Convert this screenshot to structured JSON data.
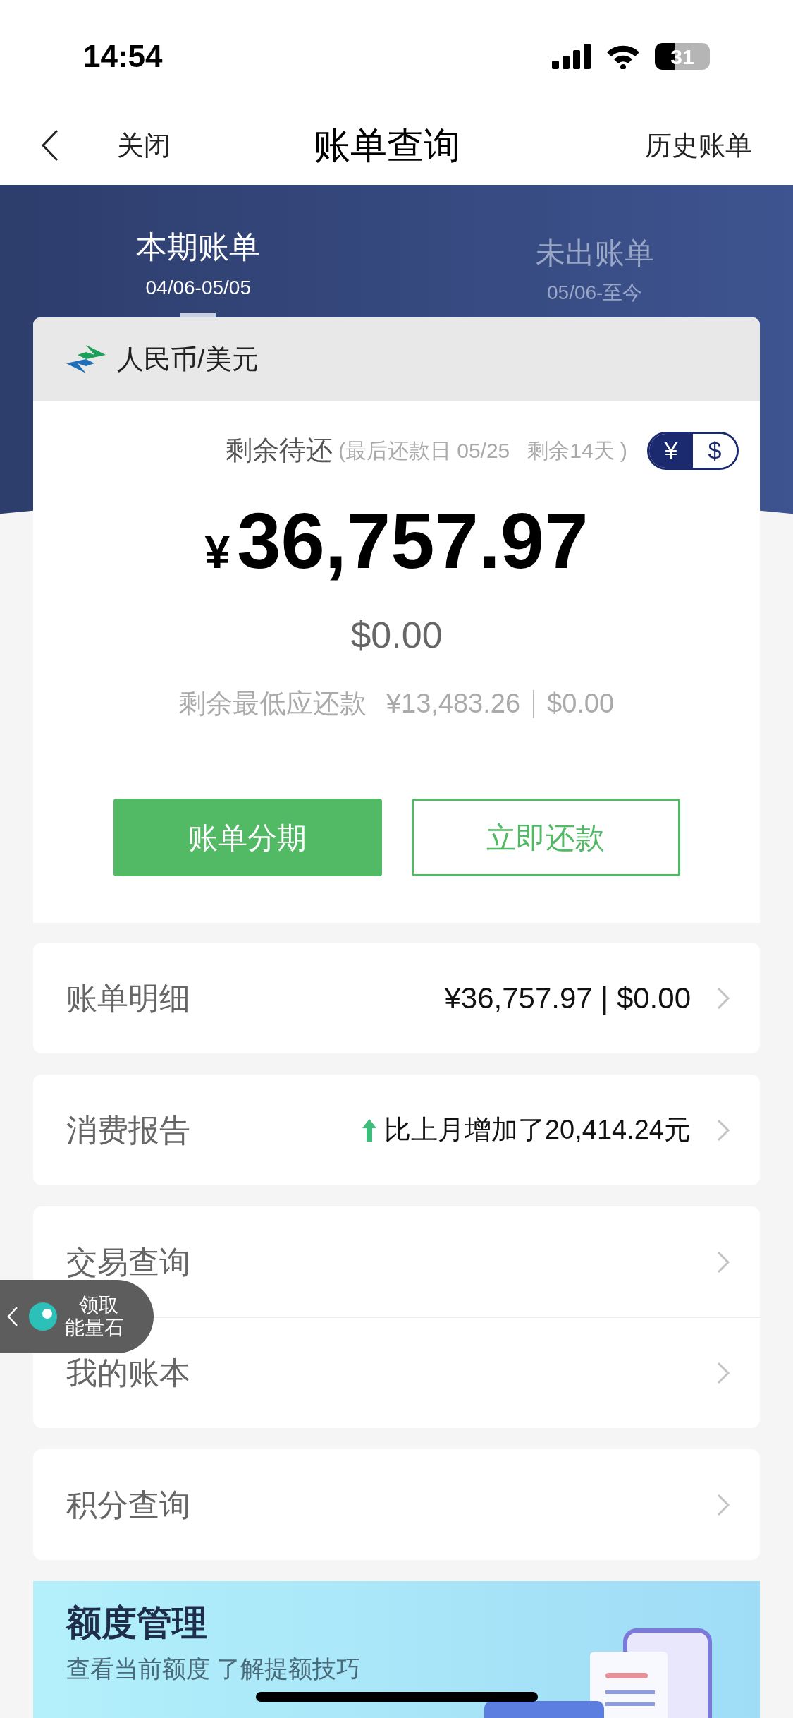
{
  "status_bar": {
    "time": "14:54",
    "battery": "31"
  },
  "nav": {
    "close": "关闭",
    "title": "账单查询",
    "history": "历史账单"
  },
  "tabs": [
    {
      "label": "本期账单",
      "range": "04/06-05/05",
      "selected": true
    },
    {
      "label": "未出账单",
      "range": "05/06-至今",
      "selected": false
    }
  ],
  "card": {
    "currency_title": "人民币/美元",
    "remaining_label": "剩余待还",
    "due_note": "(最后还款日 05/25   剩余14天 )",
    "currency_toggle": [
      {
        "label": "¥",
        "selected": true
      },
      {
        "label": "$",
        "selected": false
      }
    ],
    "currency_symbol": "¥",
    "amount": "36,757.97",
    "usd_amount": "$0.00",
    "minimum_label": "剩余最低应还款",
    "minimum_cny": "¥13,483.26",
    "minimum_usd": "$0.00",
    "buttons": [
      {
        "label": "账单分期",
        "kind": "filled"
      },
      {
        "label": "立即还款",
        "kind": "outline"
      }
    ]
  },
  "sections": [
    {
      "rows": [
        {
          "label": "账单明细",
          "kind": "amount",
          "value": "¥36,757.97 | $0.00"
        }
      ]
    },
    {
      "rows": [
        {
          "label": "消费报告",
          "kind": "trend",
          "value": "比上月增加了20,414.24元"
        }
      ]
    },
    {
      "rows": [
        {
          "label": "交易查询",
          "kind": "plain"
        },
        {
          "label": "我的账本",
          "kind": "plain"
        }
      ]
    },
    {
      "rows": [
        {
          "label": "积分查询",
          "kind": "plain"
        }
      ]
    }
  ],
  "banner": {
    "title": "额度管理",
    "subtitle": "查看当前额度 了解提额技巧"
  },
  "floating_badge": {
    "lines": [
      "领取",
      "能量石"
    ]
  }
}
